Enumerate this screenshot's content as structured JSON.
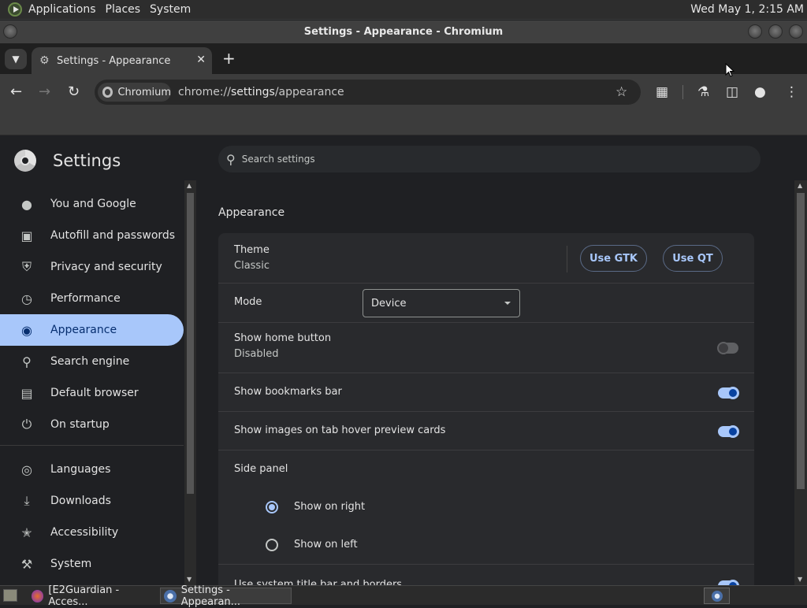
{
  "top_panel": {
    "menus": [
      "Applications",
      "Places",
      "System"
    ],
    "clock": "Wed May 1, 2:15 AM"
  },
  "window": {
    "title": "Settings - Appearance - Chromium"
  },
  "tab": {
    "title": "Settings - Appearance",
    "close": "✕",
    "new_tab": "+"
  },
  "toolbar": {
    "chip_label": "Chromium",
    "url_prefix": "chrome://",
    "url_main": "settings",
    "url_suffix": "/appearance",
    "icons": [
      "back-icon",
      "forward-icon",
      "reload-icon",
      "star-icon",
      "extensions-icon",
      "labs-icon",
      "side-panel-icon",
      "profile-icon",
      "menu-icon"
    ]
  },
  "settings": {
    "title": "Settings",
    "search_placeholder": "Search settings",
    "nav": [
      {
        "label": "You and Google",
        "icon": "person-icon"
      },
      {
        "label": "Autofill and passwords",
        "icon": "clipboard-icon"
      },
      {
        "label": "Privacy and security",
        "icon": "shield-icon"
      },
      {
        "label": "Performance",
        "icon": "speedometer-icon"
      },
      {
        "label": "Appearance",
        "icon": "palette-icon"
      },
      {
        "label": "Search engine",
        "icon": "search-icon"
      },
      {
        "label": "Default browser",
        "icon": "browser-icon"
      },
      {
        "label": "On startup",
        "icon": "power-icon"
      },
      {
        "label": "Languages",
        "icon": "globe-icon"
      },
      {
        "label": "Downloads",
        "icon": "download-icon"
      },
      {
        "label": "Accessibility",
        "icon": "accessibility-icon"
      },
      {
        "label": "System",
        "icon": "wrench-icon"
      }
    ],
    "active_nav": "Appearance"
  },
  "appearance": {
    "section_title": "Appearance",
    "theme_label": "Theme",
    "theme_value": "Classic",
    "use_gtk": "Use GTK",
    "use_qt": "Use QT",
    "mode_label": "Mode",
    "mode_value": "Device",
    "home_button_label": "Show home button",
    "home_button_value": "Disabled",
    "home_button_on": false,
    "bookmarks_bar_label": "Show bookmarks bar",
    "bookmarks_bar_on": true,
    "tab_hover_label": "Show images on tab hover preview cards",
    "tab_hover_on": true,
    "side_panel_label": "Side panel",
    "side_panel_options": [
      "Show on right",
      "Show on left"
    ],
    "side_panel_selected": "Show on right",
    "title_bar_label": "Use system title bar and borders",
    "title_bar_on": true
  },
  "taskbar": {
    "items": [
      "[E2Guardian - Acces...",
      "Settings - Appearan..."
    ]
  }
}
